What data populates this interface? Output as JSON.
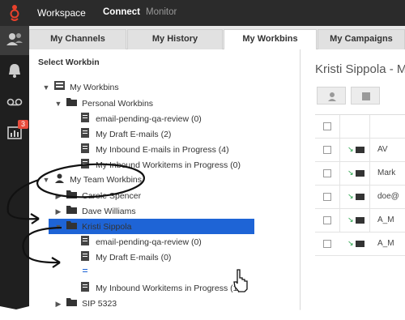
{
  "topbar": {
    "title": "Workspace",
    "nav": [
      {
        "label": "Connect",
        "active": true
      },
      {
        "label": "Monitor",
        "active": false
      }
    ]
  },
  "rail": {
    "items": [
      {
        "icon": "contacts-icon"
      },
      {
        "icon": "bell-icon"
      },
      {
        "icon": "voicemail-icon"
      },
      {
        "icon": "dashboard-icon",
        "badge": "3"
      }
    ]
  },
  "tabs": [
    {
      "label": "My Channels",
      "active": false
    },
    {
      "label": "My History",
      "active": false
    },
    {
      "label": "My Workbins",
      "active": true
    },
    {
      "label": "My Campaigns",
      "active": false
    }
  ],
  "tree": {
    "title": "Select Workbin",
    "nodes": [
      {
        "label": "My Workbins"
      },
      {
        "label": "Personal Workbins"
      },
      {
        "label": "email-pending-qa-review (0)"
      },
      {
        "label": "My Draft E-mails (2)"
      },
      {
        "label": "My Inbound E-mails in Progress (4)"
      },
      {
        "label": "My Inbound Workitems in Progress (0)"
      },
      {
        "label": "My Team Workbins"
      },
      {
        "label": "Carole Spencer"
      },
      {
        "label": "Dave Williams"
      },
      {
        "label": "Kristi Sippola"
      },
      {
        "label": "email-pending-qa-review (0)"
      },
      {
        "label": "My Draft E-mails (0)"
      },
      {
        "label": "My Inbound E-mails in Progress (5)"
      },
      {
        "label": "My Inbound Workitems in Progress (1)"
      },
      {
        "label": "SIP 5323"
      }
    ]
  },
  "right": {
    "title": "Kristi Sippola - M",
    "rows": [
      {
        "text": "AV"
      },
      {
        "text": "Mark"
      },
      {
        "text": "doe@"
      },
      {
        "text": "A_M"
      },
      {
        "text": "A_M"
      }
    ]
  },
  "colors": {
    "topbar": "#2b2b2b",
    "brand": "#e8412c",
    "selection": "#1e64d6",
    "badge": "#e74c3c"
  }
}
